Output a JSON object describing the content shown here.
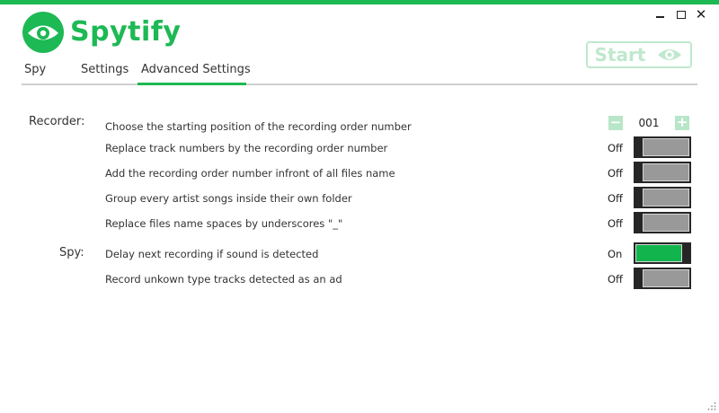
{
  "app": {
    "name": "Spytify"
  },
  "colors": {
    "accent": "#1db954",
    "accent_light": "#bfe8cd",
    "toggle_on": "#12b44e",
    "toggle_off": "#999999"
  },
  "window": {
    "minimize": "minimize",
    "maximize": "maximize",
    "close": "✕"
  },
  "tabs": [
    {
      "label": "Spy",
      "active": false
    },
    {
      "label": "Settings",
      "active": false
    },
    {
      "label": "Advanced Settings",
      "active": true
    }
  ],
  "start_button": {
    "label": "Start",
    "icon": "eye-icon"
  },
  "recorder": {
    "section_label": "Recorder:",
    "rows": [
      {
        "label": "Choose the starting position of the recording order number",
        "control": "stepper",
        "value": "001"
      },
      {
        "label": "Replace track numbers by the recording order number",
        "control": "toggle",
        "state": "Off"
      },
      {
        "label": "Add the recording order number infront of all files name",
        "control": "toggle",
        "state": "Off"
      },
      {
        "label": "Group every artist songs inside their own folder",
        "control": "toggle",
        "state": "Off"
      },
      {
        "label": "Replace files name spaces by underscores \"_\"",
        "control": "toggle",
        "state": "Off"
      }
    ]
  },
  "spy": {
    "section_label": "Spy:",
    "rows": [
      {
        "label": "Delay next recording if sound is detected",
        "control": "toggle",
        "state": "On"
      },
      {
        "label": "Record unkown type tracks detected as an ad",
        "control": "toggle",
        "state": "Off"
      }
    ]
  },
  "stepper": {
    "minus": "−",
    "plus": "+"
  }
}
